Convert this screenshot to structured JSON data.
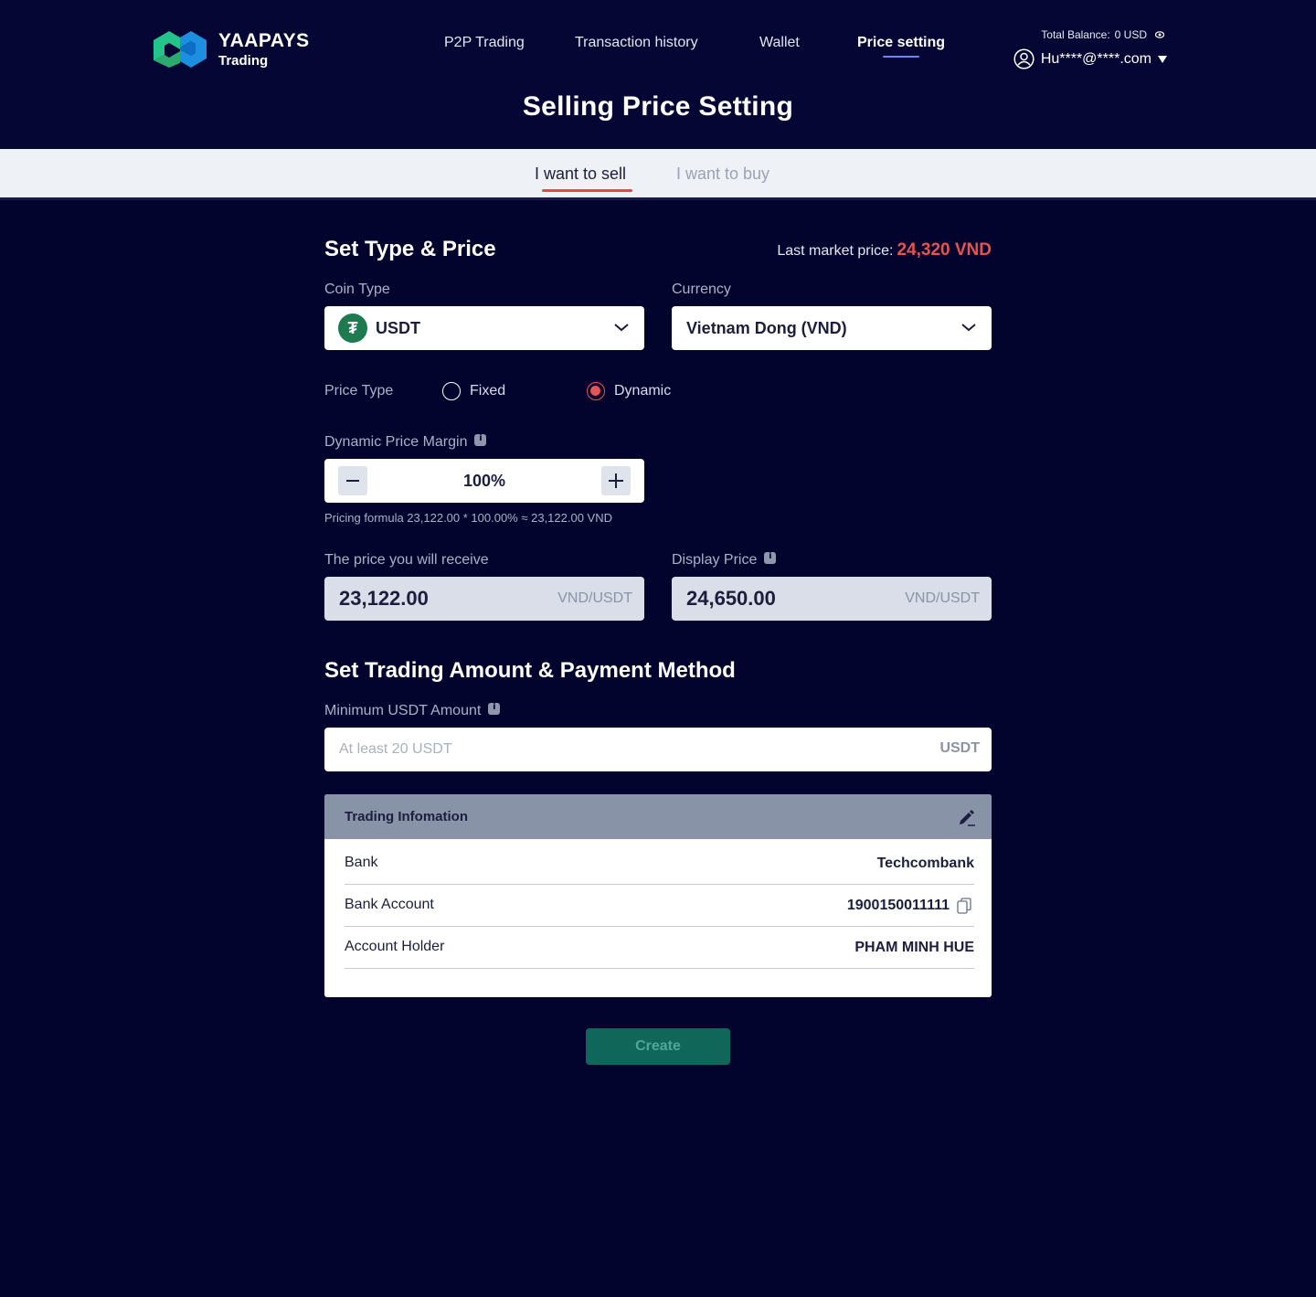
{
  "brand": {
    "name": "YAAPAYS",
    "sub": "Trading"
  },
  "nav": {
    "items": [
      {
        "label": "P2P Trading"
      },
      {
        "label": "Transaction history"
      },
      {
        "label": "Wallet"
      },
      {
        "label": "Price setting"
      }
    ],
    "active_index": 3
  },
  "account": {
    "balance_label": "Total Balance:",
    "balance_value": "0 USD",
    "user": "Hu****@****.com"
  },
  "page": {
    "title": "Selling Price Setting"
  },
  "tabs": [
    {
      "label": "I want to sell"
    },
    {
      "label": "I want to buy"
    }
  ],
  "type_price": {
    "title": "Set Type & Price",
    "market_label": "Last market price:",
    "market_value": "24,320 VND",
    "coin_label": "Coin Type",
    "coin_value": "USDT",
    "coin_symbol": "₮",
    "currency_label": "Currency",
    "currency_value": "Vietnam Dong (VND)",
    "price_type_label": "Price Type",
    "options": [
      {
        "label": "Fixed"
      },
      {
        "label": "Dynamic"
      }
    ],
    "selected_option": "Dynamic",
    "margin_label": "Dynamic Price Margin",
    "margin_value": "100%",
    "formula": "Pricing formula 23,122.00 * 100.00% ≈ 23,122.00 VND",
    "receive_label": "The price you will receive",
    "receive_value": "23,122.00",
    "receive_unit": "VND/USDT",
    "display_label": "Display Price",
    "display_value": "24,650.00",
    "display_unit": "VND/USDT"
  },
  "amount": {
    "title": "Set Trading Amount & Payment Method",
    "min_label": "Minimum USDT Amount",
    "placeholder": "At least 20 USDT",
    "unit": "USDT"
  },
  "trading_info": {
    "title": "Trading Infomation",
    "rows": [
      {
        "key": "Bank",
        "value": "Techcombank"
      },
      {
        "key": "Bank Account",
        "value": "1900150011111"
      },
      {
        "key": "Account Holder",
        "value": "PHAM MINH HUE"
      }
    ]
  },
  "create_label": "Create",
  "colors": {
    "background": "#03042e",
    "accent_red": "#e55353",
    "button_green": "#0f6659"
  }
}
